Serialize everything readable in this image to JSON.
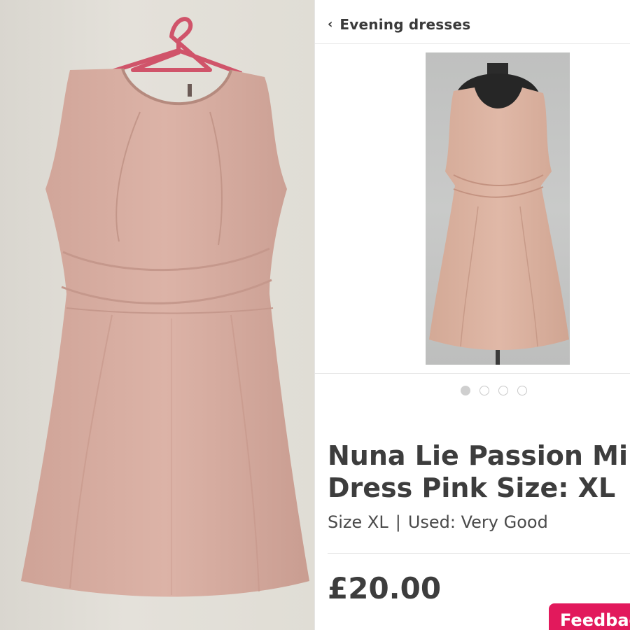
{
  "header": {
    "back_label": "Evening dresses",
    "back_icon": "chevron-left-icon"
  },
  "gallery": {
    "image_count": 4,
    "active_index": 0
  },
  "product": {
    "title": "Nuna Lie Passion Mi\nDress Pink Size: XL",
    "size": "Size XL",
    "separator": "|",
    "condition": "Used: Very Good",
    "price": "£20.00"
  },
  "feedback_tab": {
    "label": "Feedbac"
  },
  "colors": {
    "accent": "#e2195c",
    "dress": "#d9ada0",
    "text": "#3d3d3d"
  }
}
